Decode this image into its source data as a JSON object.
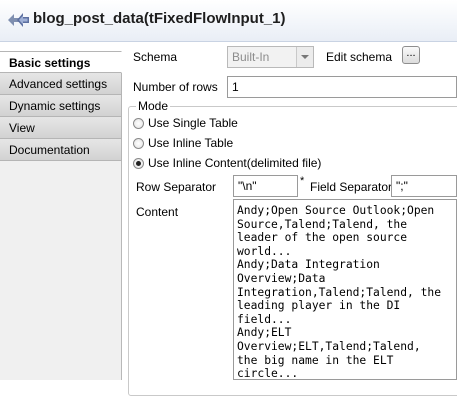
{
  "title": {
    "text": "blog_post_data(tFixedFlowInput_1)",
    "icon": "component-arrow-icon"
  },
  "nav": {
    "items": [
      {
        "label": "Basic settings",
        "active": true
      },
      {
        "label": "Advanced settings",
        "active": false
      },
      {
        "label": "Dynamic settings",
        "active": false
      },
      {
        "label": "View",
        "active": false
      },
      {
        "label": "Documentation",
        "active": false
      }
    ]
  },
  "schema": {
    "label": "Schema",
    "value": "Built-In",
    "edit_label": "Edit schema",
    "edit_button": "..."
  },
  "rows": {
    "label": "Number of rows",
    "value": "1"
  },
  "mode": {
    "legend": "Mode",
    "options": [
      {
        "label": "Use Single Table",
        "checked": false
      },
      {
        "label": "Use Inline Table",
        "checked": false
      },
      {
        "label": "Use Inline Content(delimited file)",
        "checked": true
      }
    ]
  },
  "separators": {
    "row_label": "Row Separator",
    "row_value": "\"\\n\"",
    "required_mark": "*",
    "field_label": "Field Separator",
    "field_value": "\";\""
  },
  "content": {
    "label": "Content",
    "text": "Andy;Open Source Outlook;Open\nSource,Talend;Talend, the\nleader of the open source\nworld...\nAndy;Data Integration\nOverview;Data\nIntegration,Talend;Talend, the\nleading player in the DI\nfield...\nAndy;ELT\nOverview;ELT,Talend;Talend,\nthe big name in the ELT\ncircle..."
  },
  "colors": {
    "selected_tab_bg": "#ffffff",
    "tab_bg": "#dcdcdc",
    "title_gradient_end": "#e9eef6"
  }
}
